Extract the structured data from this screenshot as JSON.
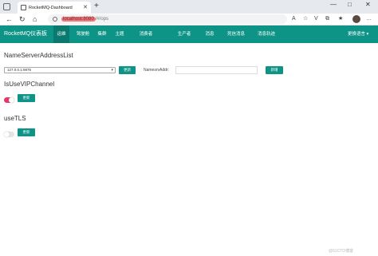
{
  "browser": {
    "tab_title": "RocketMQ-Dashboard",
    "url_host": "localhost:8080",
    "url_path": "/#/ops",
    "window_controls": {
      "minimize": "—",
      "maximize": "□",
      "close": "✕"
    },
    "new_tab": "+"
  },
  "navbar": {
    "brand": "RocketMQ仪表板",
    "items": [
      "运维",
      "驾驶舱",
      "集群",
      "主题",
      "消费者",
      "生产者",
      "消息",
      "死信消息",
      "消息轨迹"
    ],
    "language": "更换语言 ▾"
  },
  "ops": {
    "nameserver_title": "NameServerAddressList",
    "nameserver_selected": "127.0.0.1:9876",
    "update_button": "更新",
    "namesrv_label": "NamesrvAddr:",
    "namesrv_value": "",
    "add_button": "新增",
    "vip_title": "IsUseVIPChannel",
    "vip_enabled": true,
    "vip_update_button": "更新",
    "tls_title": "useTLS",
    "tls_enabled": false,
    "tls_update_button": "更新"
  },
  "watermark": "@51CTO博客",
  "colors": {
    "primary": "#0e9486",
    "toggle_on": "#e8366a"
  }
}
